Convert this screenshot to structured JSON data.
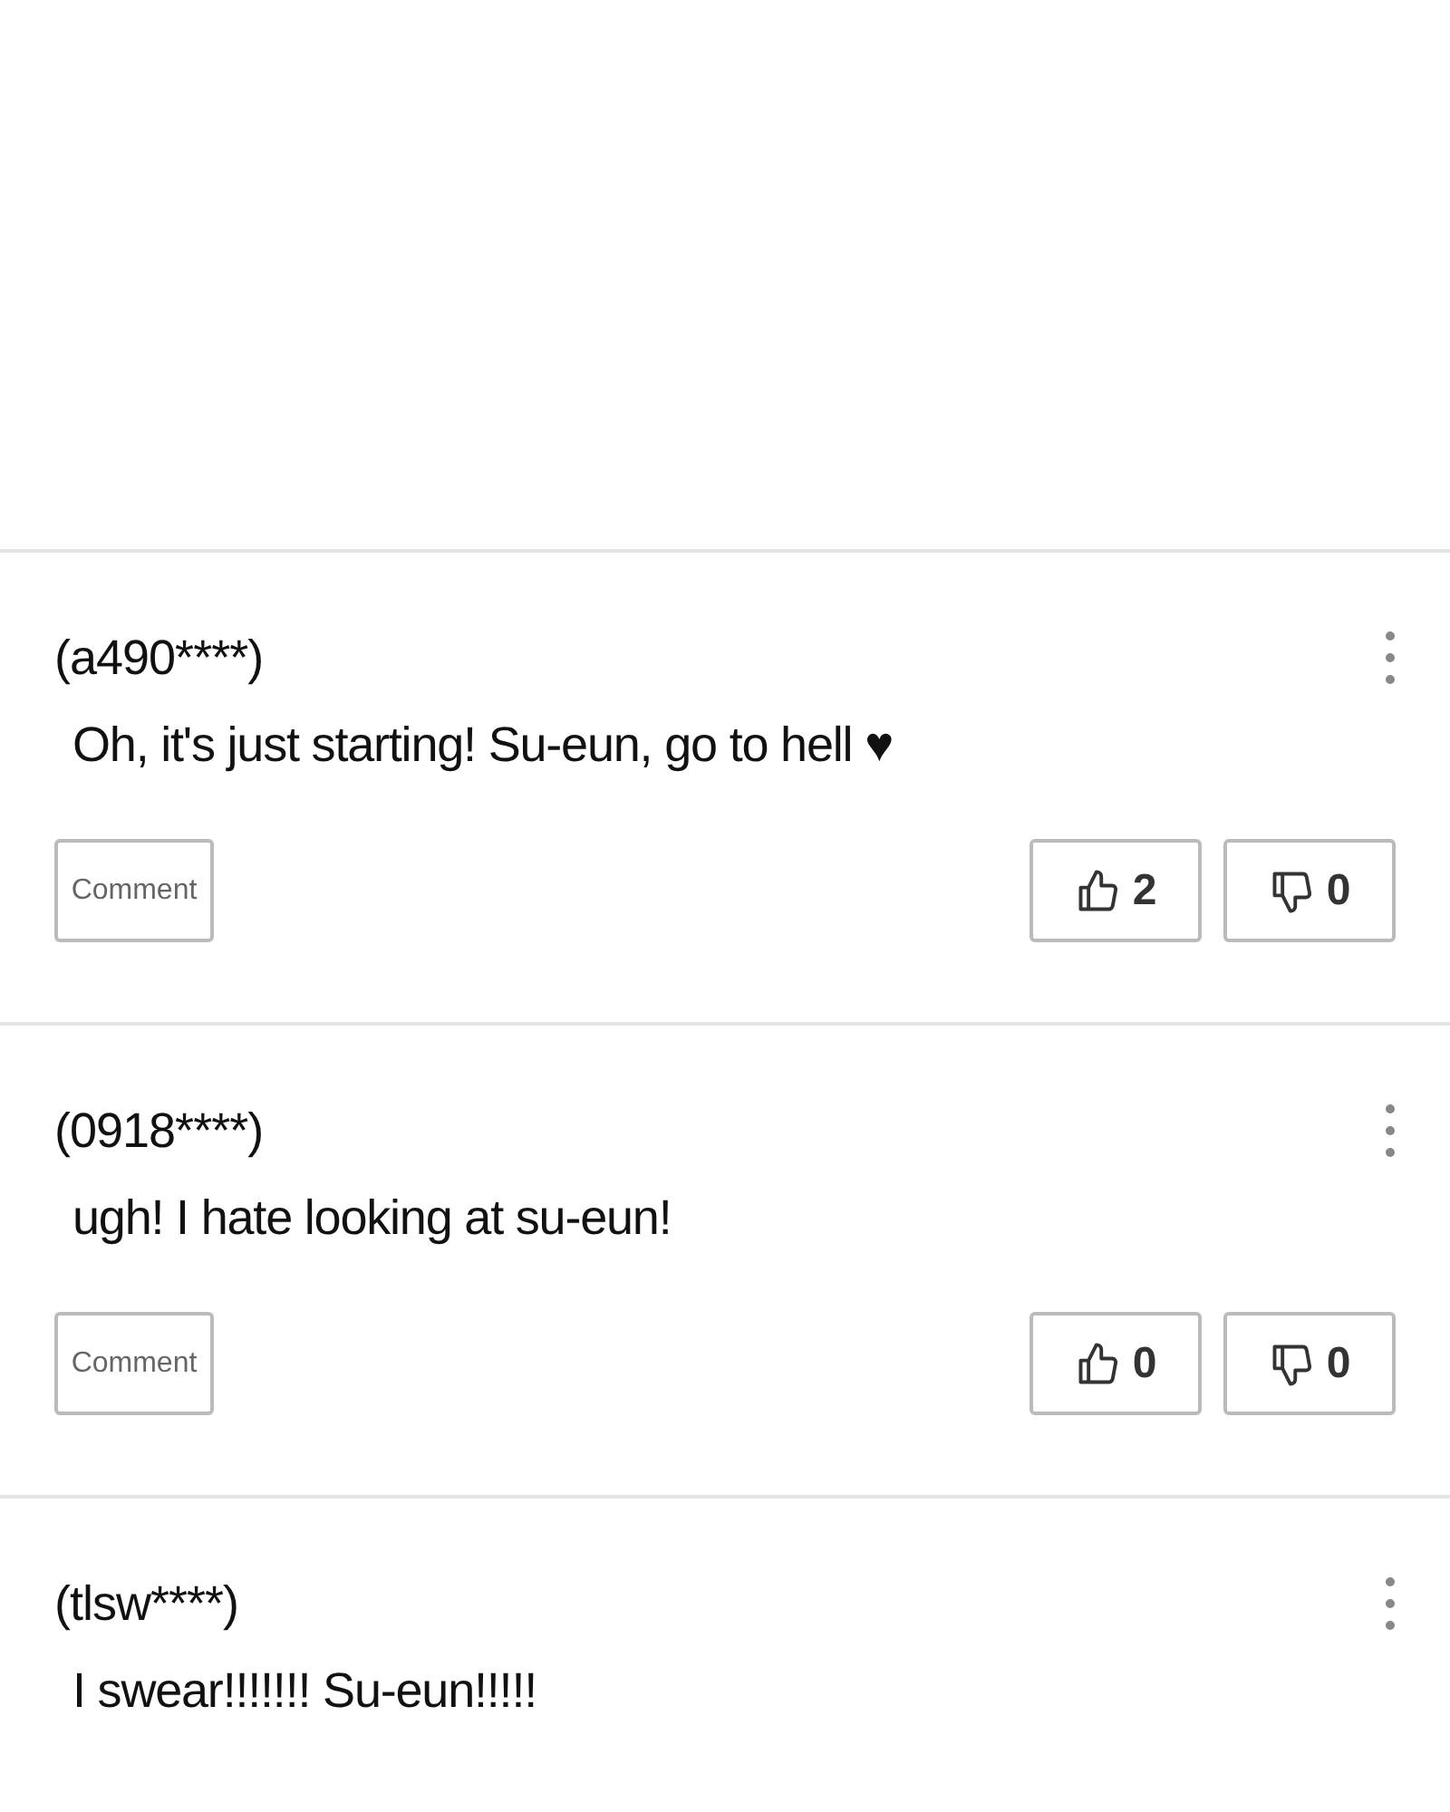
{
  "comments": [
    {
      "user": "(a490****)",
      "text": "Oh, it's just starting! Su-eun, go to hell ♥",
      "actions": {
        "reply": "Comment",
        "likes": "2",
        "dislikes": "0"
      }
    },
    {
      "user": "(0918****)",
      "text": "ugh! I hate looking at su-eun!",
      "actions": {
        "reply": "Comment",
        "likes": "0",
        "dislikes": "0"
      }
    },
    {
      "user": "(tlsw****)",
      "text": "I swear!!!!!!! Su-eun!!!!!"
    }
  ]
}
